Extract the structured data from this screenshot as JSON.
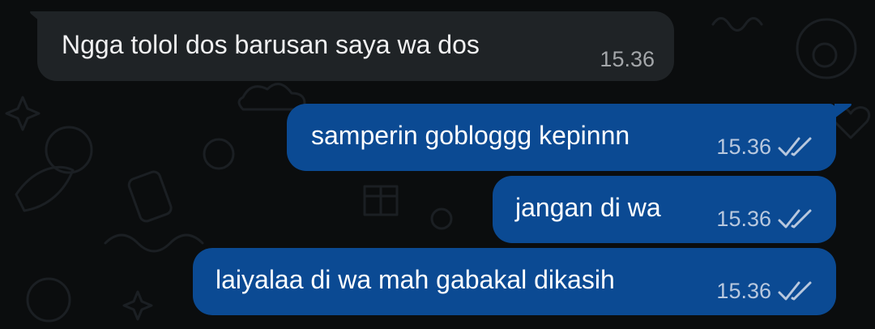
{
  "messages": [
    {
      "direction": "incoming",
      "text": "Ngga tolol dos barusan saya wa dos",
      "time": "15.36",
      "status": null
    },
    {
      "direction": "outgoing",
      "text": "samperin gobloggg kepinnn",
      "time": "15.36",
      "status": "read-double-check-icon"
    },
    {
      "direction": "outgoing",
      "text": "jangan di wa",
      "time": "15.36",
      "status": "read-double-check-icon"
    },
    {
      "direction": "outgoing",
      "text": "laiyalaa di wa mah gabakal dikasih",
      "time": "15.36",
      "status": "read-double-check-icon"
    }
  ],
  "colors": {
    "background": "#0b0d0e",
    "incoming_bubble": "#1f2326",
    "outgoing_bubble": "#0b4a93",
    "doodle": "#1c2024"
  }
}
